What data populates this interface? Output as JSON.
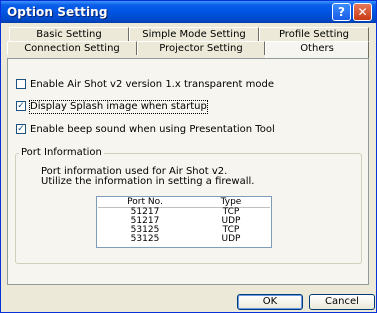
{
  "window": {
    "title": "Option Setting",
    "help_glyph": "?",
    "close_glyph": "✕"
  },
  "tabs_row1": [
    "Basic Setting",
    "Simple Mode Setting",
    "Profile Setting"
  ],
  "tabs_row2": [
    "Connection Setting",
    "Projector Setting",
    "Others"
  ],
  "active_tab": "Others",
  "options": [
    {
      "label": "Enable Air Shot v2 version 1.x transparent mode",
      "checked": false
    },
    {
      "label": "Display Splash image when startup",
      "checked": true
    },
    {
      "label": "Enable beep sound when using Presentation Tool",
      "checked": true
    }
  ],
  "port_group": {
    "title": "Port Information",
    "line1": "Port information used for Air Shot v2.",
    "line2": "Utilize the information in setting a firewall.",
    "columns": [
      "Port No.",
      "Type"
    ],
    "rows": [
      [
        "51217",
        "TCP"
      ],
      [
        "51217",
        "UDP"
      ],
      [
        "53125",
        "TCP"
      ],
      [
        "53125",
        "UDP"
      ]
    ]
  },
  "buttons": {
    "ok": "OK",
    "cancel": "Cancel"
  },
  "colors": {
    "titlebar": "#0054e3",
    "dialog_bg": "#ece9d8",
    "panel_bg": "#f6f5ef",
    "check": "#1c5180"
  }
}
